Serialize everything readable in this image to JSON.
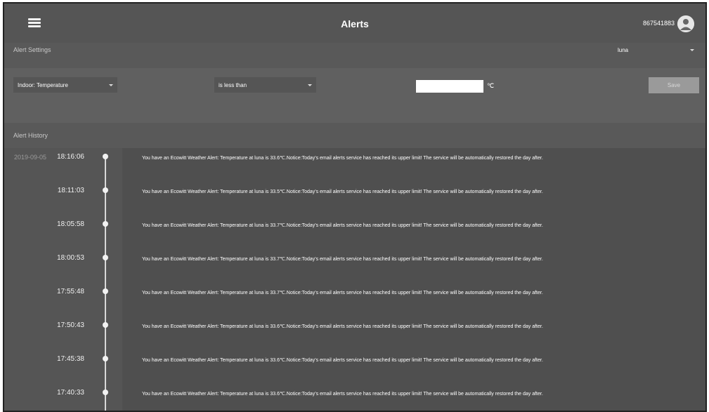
{
  "header": {
    "title": "Alerts",
    "user_id": "867541883",
    "menu_icon": "hamburger-menu-icon",
    "avatar_icon": "user-avatar-icon"
  },
  "settings": {
    "label": "Alert Settings",
    "station_select": "luna",
    "metric_select": "Indoor: Temperature",
    "condition_select": "is less than",
    "threshold_value": "",
    "unit": "℃",
    "save_label": "Save"
  },
  "history": {
    "label": "Alert History",
    "entries": [
      {
        "date": "2019-09-05",
        "time": "18:16:06",
        "message": "You have an Ecowitt Weather Alert: Temperature at luna is 33.6℃.Notice:Today's email alerts service has reached its upper limit! The service will be automatically restored the day after."
      },
      {
        "date": "",
        "time": "18:11:03",
        "message": "You have an Ecowitt Weather Alert: Temperature at luna is 33.5℃.Notice:Today's email alerts service has reached its upper limit! The service will be automatically restored the day after."
      },
      {
        "date": "",
        "time": "18:05:58",
        "message": "You have an Ecowitt Weather Alert: Temperature at luna is 33.7℃.Notice:Today's email alerts service has reached its upper limit! The service will be automatically restored the day after."
      },
      {
        "date": "",
        "time": "18:00:53",
        "message": "You have an Ecowitt Weather Alert: Temperature at luna is 33.7℃.Notice:Today's email alerts service has reached its upper limit! The service will be automatically restored the day after."
      },
      {
        "date": "",
        "time": "17:55:48",
        "message": "You have an Ecowitt Weather Alert: Temperature at luna is 33.7℃.Notice:Today's email alerts service has reached its upper limit! The service will be automatically restored the day after."
      },
      {
        "date": "",
        "time": "17:50:43",
        "message": "You have an Ecowitt Weather Alert: Temperature at luna is 33.6℃.Notice:Today's email alerts service has reached its upper limit! The service will be automatically restored the day after."
      },
      {
        "date": "",
        "time": "17:45:38",
        "message": "You have an Ecowitt Weather Alert: Temperature at luna is 33.6℃.Notice:Today's email alerts service has reached its upper limit! The service will be automatically restored the day after."
      },
      {
        "date": "",
        "time": "17:40:33",
        "message": "You have an Ecowitt Weather Alert: Temperature at luna is 33.6℃.Notice:Today's email alerts service has reached its upper limit! The service will be automatically restored the day after."
      }
    ]
  }
}
